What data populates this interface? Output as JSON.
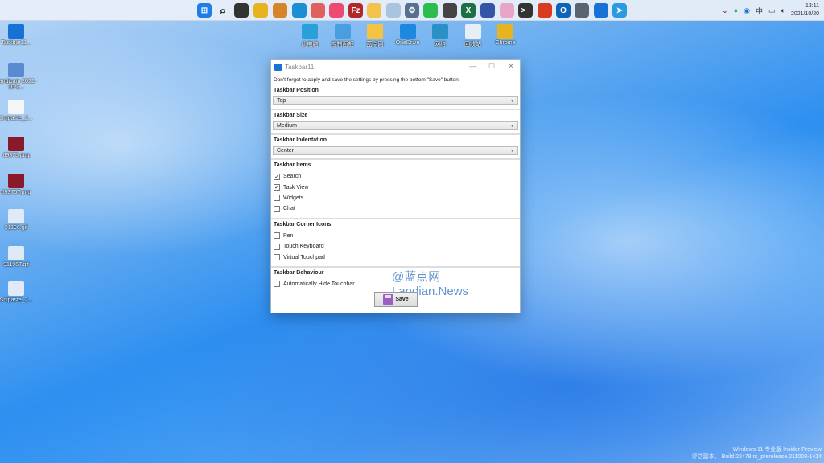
{
  "taskbar": {
    "apps": [
      {
        "name": "start",
        "color": "#1f7de6",
        "glyph": "⊞"
      },
      {
        "name": "search",
        "color": "transparent",
        "glyph": "⌕"
      },
      {
        "name": "task-view",
        "color": "#333",
        "glyph": ""
      },
      {
        "name": "chrome",
        "color": "#e8b321",
        "glyph": ""
      },
      {
        "name": "chrome-canary",
        "color": "#d6862a",
        "glyph": ""
      },
      {
        "name": "edge",
        "color": "#1b8fd2",
        "glyph": ""
      },
      {
        "name": "app-red-pen",
        "color": "#e06060",
        "glyph": ""
      },
      {
        "name": "app-pink",
        "color": "#ec4a6e",
        "glyph": ""
      },
      {
        "name": "filezilla",
        "color": "#b3262a",
        "glyph": "Fz"
      },
      {
        "name": "file-explorer",
        "color": "#f3c24c",
        "glyph": ""
      },
      {
        "name": "photos",
        "color": "#a9c4e0",
        "glyph": ""
      },
      {
        "name": "settings",
        "color": "#57708f",
        "glyph": "⚙"
      },
      {
        "name": "wechat",
        "color": "#2dbd4e",
        "glyph": ""
      },
      {
        "name": "app-scanner",
        "color": "#444",
        "glyph": ""
      },
      {
        "name": "excel",
        "color": "#1d7044",
        "glyph": "X"
      },
      {
        "name": "remote-desktop",
        "color": "#3454a5",
        "glyph": ""
      },
      {
        "name": "app-pink-circle",
        "color": "#e9a4c8",
        "glyph": ""
      },
      {
        "name": "terminal",
        "color": "#333",
        "glyph": ">_"
      },
      {
        "name": "app-red-circle",
        "color": "#d83b1e",
        "glyph": ""
      },
      {
        "name": "outlook",
        "color": "#0f63b5",
        "glyph": "O"
      },
      {
        "name": "calculator",
        "color": "#5a6470",
        "glyph": ""
      },
      {
        "name": "taskbar11",
        "color": "#1672d4",
        "glyph": ""
      },
      {
        "name": "telegram",
        "color": "#2a9be0",
        "glyph": "➤"
      }
    ],
    "clock_time": "13:11",
    "clock_date": "2021/10/20"
  },
  "desktop_top": [
    {
      "label": "此电脑",
      "color": "#2aa0d8"
    },
    {
      "label": "控制面板",
      "color": "#4a9ee0"
    },
    {
      "label": "蓝点网",
      "color": "#f5c342"
    },
    {
      "label": "OneDrive",
      "color": "#1e88e0"
    },
    {
      "label": "网络",
      "color": "#2a90c8"
    },
    {
      "label": "回收站",
      "color": "#e8eef5"
    },
    {
      "label": "Chrome",
      "color": "#e8b321"
    }
  ],
  "desktop_left": [
    {
      "label": "Taskbar11...",
      "color": "#1672d4"
    },
    {
      "label": "bandicam 2021-10-2...",
      "color": "#5a8ad0"
    },
    {
      "label": "Snipaste_2...",
      "color": "#f4f6f8"
    },
    {
      "label": "69375.png",
      "color": "#8a1a2a"
    },
    {
      "label": "69375T.png",
      "color": "#8a1a2a"
    },
    {
      "label": "91196.gif",
      "color": "#dfeaf6"
    },
    {
      "label": "91196T.gif",
      "color": "#dfeaf6"
    },
    {
      "label": "Snipaste_2...",
      "color": "#dfeaf6"
    }
  ],
  "window": {
    "title": "Taskbar11",
    "note": "Don't forget to apply and save the settings by pressing the bottom \"Save\" button.",
    "position": {
      "label": "Taskbar Position",
      "value": "Top"
    },
    "size": {
      "label": "Taskbar Size",
      "value": "Medium"
    },
    "indentation": {
      "label": "Taskbar Indentation",
      "value": "Center"
    },
    "items": {
      "label": "Taskbar Items",
      "options": [
        {
          "label": "Search",
          "checked": true
        },
        {
          "label": "Task View",
          "checked": true
        },
        {
          "label": "Widgets",
          "checked": false
        },
        {
          "label": "Chat",
          "checked": false
        }
      ]
    },
    "corner": {
      "label": "Taskbar Corner Icons",
      "options": [
        {
          "label": "Pen",
          "checked": false
        },
        {
          "label": "Touch Keyboard",
          "checked": false
        },
        {
          "label": "Virtual Touchpad",
          "checked": false
        }
      ]
    },
    "behaviour": {
      "label": "Taskbar Behaviour",
      "options": [
        {
          "label": "Automatically Hide Touchbar",
          "checked": false
        }
      ]
    },
    "save_label": "Save"
  },
  "watermark": "@蓝点网 Landian.News",
  "build": {
    "line1": "Windows 11 专业版 Insider Preview",
    "line2": "评估副本。 Build 22478.rs_prerelease.211008-1414"
  }
}
